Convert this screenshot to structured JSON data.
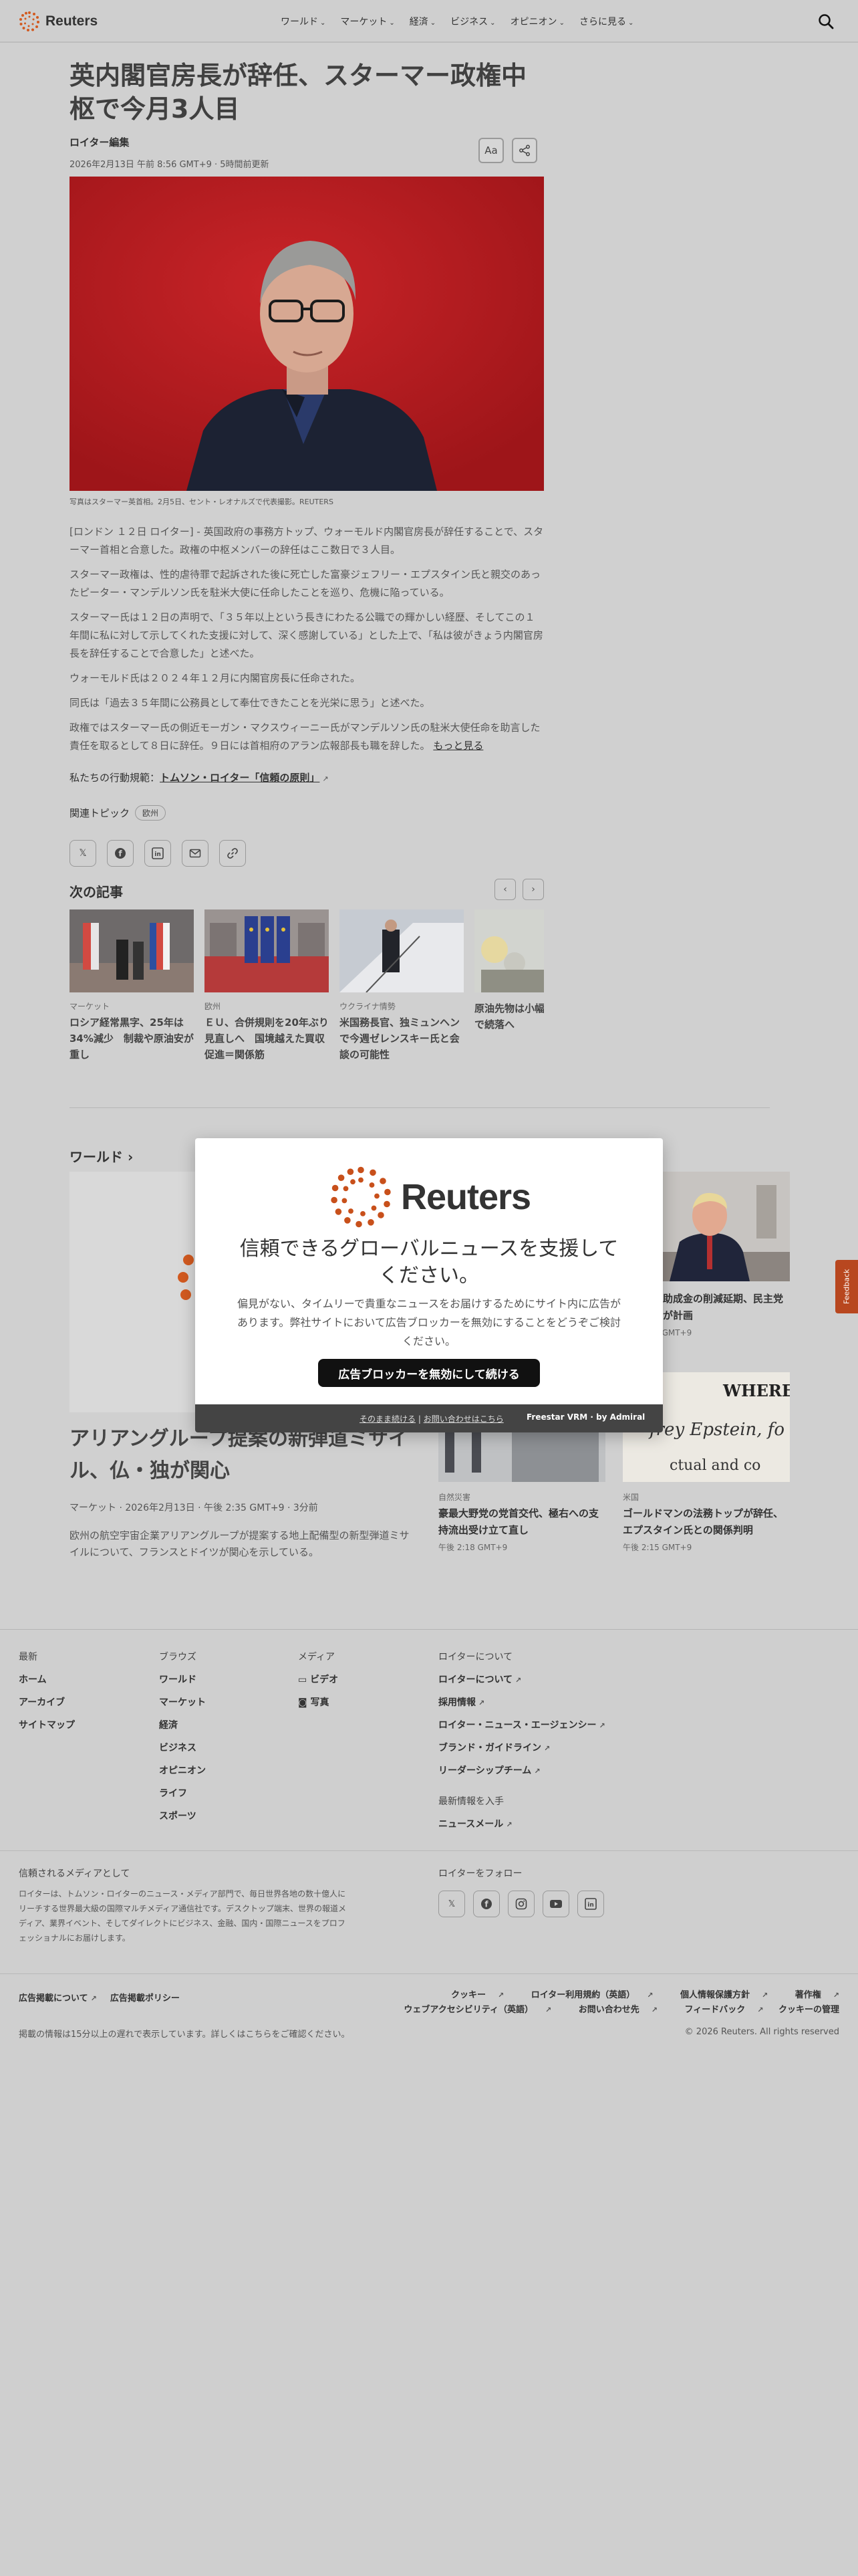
{
  "brand": {
    "name": "Reuters",
    "accent": "#d25a20"
  },
  "nav": {
    "items": [
      {
        "label": "ワールド"
      },
      {
        "label": "マーケット"
      },
      {
        "label": "経済"
      },
      {
        "label": "ビジネス"
      },
      {
        "label": "オピニオン"
      },
      {
        "label": "さらに見る"
      }
    ],
    "search_icon": "search-icon"
  },
  "article": {
    "headline": "英内閣官房長が辞任、スターマー政権中枢で今月3人目",
    "byline": "ロイター編集",
    "dateline": "2026年2月13日 午前 8:56 GMT+9 · 5時間前更新",
    "text_size_label": "Aa",
    "caption": "写真はスターマー英首相。2月5日、セント・レオナルズで代表撮影。REUTERS",
    "paragraphs": [
      "[ロンドン １２日 ロイター] - 英国政府の事務方トップ、ウォーモルド内閣官房長が辞任することで、スターマー首相と合意した。政権の中枢メンバーの辞任はここ数日で３人目。",
      "スターマー政権は、性的虐待罪で起訴された後に死亡した富豪ジェフリー・エプスタイン氏と親交のあったピーター・マンデルソン氏を駐米大使に任命したことを巡り、危機に陥っている。",
      "スターマー氏は１２日の声明で、「３５年以上という長きにわたる公職での輝かしい経歴、そしてこの１年間に私に対して示してくれた支援に対して、深く感謝している」とした上で、「私は彼がきょう内閣官房長を辞任することで合意した」と述べた。",
      "ウォーモルド氏は２０２４年１２月に内閣官房長に任命された。",
      "同氏は「過去３５年間に公務員として奉仕できたことを光栄に思う」と述べた。",
      "政権ではスターマー氏の側近モーガン・マクスウィーニー氏がマンデルソン氏の駐米大使任命を助言した責任を取るとして８日に辞任。９日には首相府のアラン広報部長も職を辞した。"
    ],
    "read_more": "もっと見る",
    "principles_prefix": "私たちの行動規範：",
    "principles_link": "トムソン・ロイター「信頼の原則」",
    "topics_label": "関連トピック",
    "topic_chip": "欧州"
  },
  "share": [
    "x-icon",
    "facebook-icon",
    "linkedin-icon",
    "email-icon",
    "link-icon"
  ],
  "next": {
    "title": "次の記事",
    "cards": [
      {
        "category": "マーケット",
        "headline": "ロシア経常黒字、25年は34%減少　制裁や原油安が重し"
      },
      {
        "category": "欧州",
        "headline": "ＥＵ、合併規則を20年ぶり見直しへ　国境越えた買収促進＝関係筋"
      },
      {
        "category": "ウクライナ情勢",
        "headline": "米国務長官、独ミュンヘンで今週ゼレンスキー氏と会談の可能性"
      },
      {
        "category": "",
        "headline": "原油先物は小幅リスク後退で続落へ"
      }
    ]
  },
  "world": {
    "title": "ワールド",
    "feature": {
      "headline": "アリアングループ提案の新弾道ミサイル、仏・独が関心",
      "meta": "マーケット · 2026年2月13日 · 午後 2:35 GMT+9 · 3分前",
      "desc": "欧州の航空宇宙企業アリアングループが提案する地上配備型の新型弾道ミサイルについて、フランスとドイツが関心を示している。"
    },
    "side": [
      {
        "category": "",
        "headline": "公衆衛生助成金の削減延期、民主党州で政権が計画",
        "time": "午後 2:20 GMT+9"
      },
      {
        "category": "自然災害",
        "headline": "豪最大野党の党首交代、極右への支持流出受け立て直し",
        "time": "午後 2:18 GMT+9"
      },
      {
        "category": "米国",
        "headline": "ゴールドマンの法務トップが辞任、エプスタイン氏との関係判明",
        "time": "午後 2:15 GMT+9"
      }
    ]
  },
  "feedback_label": "Feedback",
  "modal": {
    "title": "信頼できるグローバルニュースを支援してください。",
    "desc": "偏見がない、タイムリーで貴重なニュースをお届けするためにサイト内に広告があります。弊社サイトにおいて広告ブロッカーを無効にすることをどうぞご検討ください。",
    "cta": "広告ブロッカーを無効にして続ける",
    "continue_link": "そのまま続ける",
    "contact_link": "お問い合わせはこちら",
    "powered": "Freestar VRM · by Admiral"
  },
  "footer": {
    "columns": [
      {
        "heading": "最新",
        "links": [
          "ホーム",
          "アーカイブ",
          "サイトマップ"
        ]
      },
      {
        "heading": "ブラウズ",
        "links": [
          "ワールド",
          "マーケット",
          "経済",
          "ビジネス",
          "オピニオン",
          "ライフ",
          "スポーツ"
        ]
      },
      {
        "heading": "メディア",
        "links": [
          "ビデオ",
          "写真"
        ]
      },
      {
        "heading": "ロイターについて",
        "links": [
          "ロイターについて",
          "採用情報",
          "ロイター・ニュース・エージェンシー",
          "ブランド・ガイドライン",
          "リーダーシップチーム"
        ]
      }
    ],
    "newsletter_heading": "最新情報を入手",
    "newsletter_link": "ニュースメール",
    "trusted_heading": "信頼されるメディアとして",
    "trusted_text": "ロイターは、トムソン・ロイターのニュース・メディア部門で、毎日世界各地の数十億人にリーチする世界最大級の国際マルチメディア通信社です。デスクトップ端末、世界の報道メディア、業界イベント、そしてダイレクトにビジネス、金融、国内・国際ニュースをプロフェッショナルにお届けします。",
    "follow_heading": "ロイターをフォロー",
    "social": [
      "x-icon",
      "facebook-icon",
      "instagram-icon",
      "youtube-icon",
      "linkedin-icon"
    ],
    "legal_left": [
      "広告掲載について",
      "広告掲載ポリシー"
    ],
    "legal_right_1": [
      "クッキー",
      "ロイター利用規約（英語）",
      "個人情報保護方針",
      "著作権"
    ],
    "legal_right_2": [
      "ウェブアクセシビリティ（英語）",
      "お問い合わせ先",
      "フィードバック",
      "クッキーの管理"
    ],
    "delay_note": "掲載の情報は15分以上の遅れで表示しています。詳しくはこちらをご確認ください。",
    "copyright": "© 2026 Reuters. All rights reserved"
  }
}
